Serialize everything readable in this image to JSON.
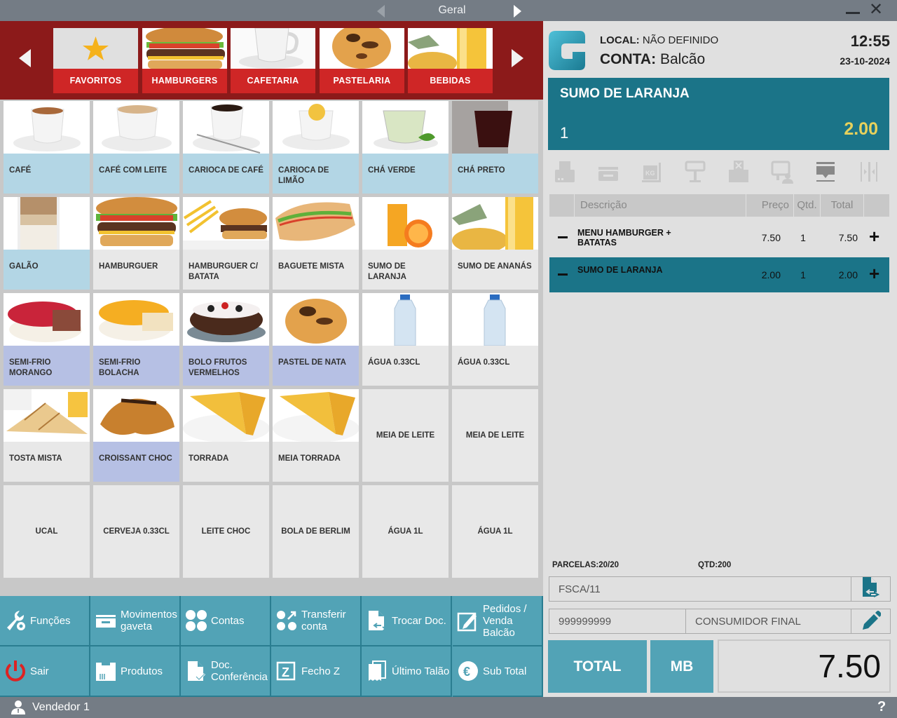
{
  "titlebar": {
    "section": "Geral",
    "prev_icon": "triangle-left-icon",
    "next_icon": "triangle-right-icon",
    "minimize_icon": "minimize-icon",
    "close_icon": "close-icon"
  },
  "categories": [
    {
      "label": "FAVORITOS",
      "icon": "star-icon"
    },
    {
      "label": "HAMBURGERS",
      "icon": "hamburger-image"
    },
    {
      "label": "CAFETARIA",
      "icon": "coffee-cup-image"
    },
    {
      "label": "PASTELARIA",
      "icon": "pastry-image"
    },
    {
      "label": "BEBIDAS",
      "icon": "juice-image"
    }
  ],
  "products": [
    {
      "label": "CAFÉ",
      "color": "blue",
      "image": "espresso-cup"
    },
    {
      "label": "CAFÉ COM LEITE",
      "color": "blue",
      "image": "latte-cup"
    },
    {
      "label": "CARIOCA DE CAFÉ",
      "color": "blue",
      "image": "black-coffee-cup"
    },
    {
      "label": "CARIOCA DE LIMÃO",
      "color": "blue",
      "image": "lemon-tea-cup"
    },
    {
      "label": "CHÁ VERDE",
      "color": "blue",
      "image": "green-tea-cup"
    },
    {
      "label": "CHÁ PRETO",
      "color": "blue",
      "image": "black-tea-glass"
    },
    {
      "label": "GALÃO",
      "color": "blue",
      "image": "galao-glass"
    },
    {
      "label": "HAMBURGUER",
      "color": "gray",
      "image": "burger"
    },
    {
      "label": "HAMBURGUER C/ BATATA",
      "color": "gray",
      "image": "burger-fries"
    },
    {
      "label": "BAGUETE MISTA",
      "color": "gray",
      "image": "baguette"
    },
    {
      "label": "SUMO DE LARANJA",
      "color": "gray",
      "image": "orange-juice"
    },
    {
      "label": "SUMO DE ANANÁS",
      "color": "gray",
      "image": "pineapple-juice"
    },
    {
      "label": "SEMI-FRIO MORANGO",
      "color": "lav",
      "image": "strawberry-cake"
    },
    {
      "label": "SEMI-FRIO BOLACHA",
      "color": "lav",
      "image": "biscuit-cake"
    },
    {
      "label": "BOLO FRUTOS VERMELHOS",
      "color": "lav",
      "image": "berry-cake"
    },
    {
      "label": "PASTEL DE NATA",
      "color": "lav",
      "image": "custard-tart"
    },
    {
      "label": "ÁGUA 0.33CL",
      "color": "gray",
      "image": "water-bottle"
    },
    {
      "label": "ÁGUA 0.33CL",
      "color": "gray",
      "image": "water-bottle"
    },
    {
      "label": "TOSTA MISTA",
      "color": "gray",
      "image": "toastie"
    },
    {
      "label": "CROISSANT CHOC",
      "color": "lav",
      "image": "croissant"
    },
    {
      "label": "TORRADA",
      "color": "gray",
      "image": "toast"
    },
    {
      "label": "MEIA TORRADA",
      "color": "gray",
      "image": "toast"
    },
    {
      "label": "MEIA DE LEITE",
      "color": "textonly",
      "image": ""
    },
    {
      "label": "MEIA DE LEITE",
      "color": "textonly",
      "image": ""
    },
    {
      "label": "UCAL",
      "color": "textonly",
      "image": ""
    },
    {
      "label": "CERVEJA 0.33CL",
      "color": "textonly",
      "image": ""
    },
    {
      "label": "LEITE CHOC",
      "color": "textonly",
      "image": ""
    },
    {
      "label": "BOLA DE BERLIM",
      "color": "textonly",
      "image": ""
    },
    {
      "label": "ÁGUA 1L",
      "color": "textonly",
      "image": ""
    },
    {
      "label": "ÁGUA 1L",
      "color": "textonly",
      "image": ""
    }
  ],
  "functions": [
    {
      "label": "Funções",
      "icon": "wrench-gear-icon"
    },
    {
      "label": "Movimentos gaveta",
      "icon": "cash-drawer-icon"
    },
    {
      "label": "Contas",
      "icon": "four-dots-icon"
    },
    {
      "label": "Transferir conta",
      "icon": "transfer-dots-icon"
    },
    {
      "label": "Trocar Doc.",
      "icon": "document-swap-icon"
    },
    {
      "label": "Pedidos / Venda Balcão",
      "icon": "edit-square-icon"
    },
    {
      "label": "Sair",
      "icon": "power-icon"
    },
    {
      "label": "Produtos",
      "icon": "product-box-icon"
    },
    {
      "label": "Doc. Conferência",
      "icon": "document-check-icon"
    },
    {
      "label": "Fecho Z",
      "icon": "z-box-icon"
    },
    {
      "label": "Último Talão",
      "icon": "receipt-icon"
    },
    {
      "label": "Sub Total",
      "icon": "euro-icon"
    }
  ],
  "status": {
    "user": "Vendedor 1",
    "help": "?"
  },
  "header": {
    "local_label": "LOCAL:",
    "local_value": "NÃO DEFINIDO",
    "conta_label": "CONTA:",
    "conta_value": "Balcão",
    "time": "12:55",
    "date": "23-10-2024"
  },
  "selected": {
    "name": "SUMO DE LARANJA",
    "qty": "1",
    "price": "2.00"
  },
  "tools": [
    "printer-icon",
    "drawer-icon",
    "scale-kg-icon",
    "display-pole-icon",
    "cancel-print-icon",
    "customer-display-icon",
    "collapse-icon",
    "split-icon"
  ],
  "table": {
    "headers": {
      "desc": "Descrição",
      "price": "Preço",
      "qty": "Qtd.",
      "total": "Total"
    },
    "rows": [
      {
        "desc": "MENU HAMBURGER + BATATAS",
        "price": "7.50",
        "qty": "1",
        "total": "7.50",
        "selected": false
      },
      {
        "desc": "SUMO DE LARANJA",
        "price": "2.00",
        "qty": "1",
        "total": "2.00",
        "selected": true
      }
    ]
  },
  "summary": {
    "parcelas": "PARCELAS:20/20",
    "qtd": "QTD:200"
  },
  "document": {
    "series": "FSCA/11",
    "nif": "999999999",
    "client": "CONSUMIDOR FINAL"
  },
  "payment": {
    "total_label": "TOTAL",
    "mb_label": "MB",
    "amount": "7.50"
  },
  "colors": {
    "brand_red": "#cf2626",
    "dark_red": "#8c1a1a",
    "teal": "#1b7488",
    "button_teal": "#52a3b6",
    "price_yellow": "#e7d15c"
  }
}
